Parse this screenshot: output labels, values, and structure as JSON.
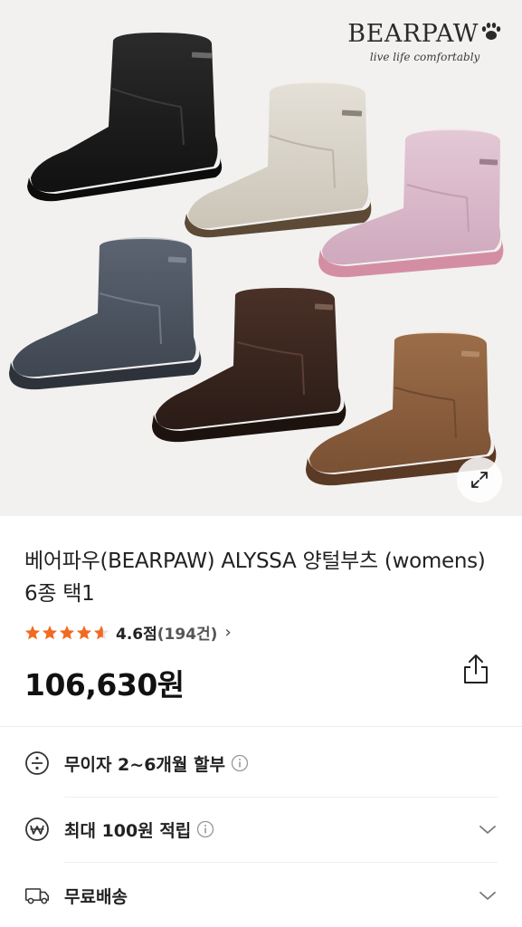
{
  "brand": {
    "name": "BEARPAW",
    "tagline": "live life comfortably"
  },
  "product": {
    "title": "베어파우(BEARPAW) ALYSSA 양털부츠 (womens) 6종 택1",
    "rating": {
      "stars": 4.6,
      "score_text": "4.6점",
      "count_text": "(194건)"
    },
    "price": "106,630원"
  },
  "benefits": [
    {
      "label": "무이자 2~6개월 할부",
      "icon": "installment-icon",
      "has_info": true,
      "has_chevron": false
    },
    {
      "label": "최대 100원 적립",
      "icon": "won-coin-icon",
      "has_info": true,
      "has_chevron": true
    },
    {
      "label": "무료배송",
      "icon": "truck-icon",
      "has_info": false,
      "has_chevron": true
    }
  ],
  "colors": {
    "star": "#f26a21",
    "boots": [
      "#1c1c1c",
      "#d9d4ca",
      "#d7b8c8",
      "#4b5360",
      "#3a2620",
      "#8a5f3e"
    ]
  }
}
